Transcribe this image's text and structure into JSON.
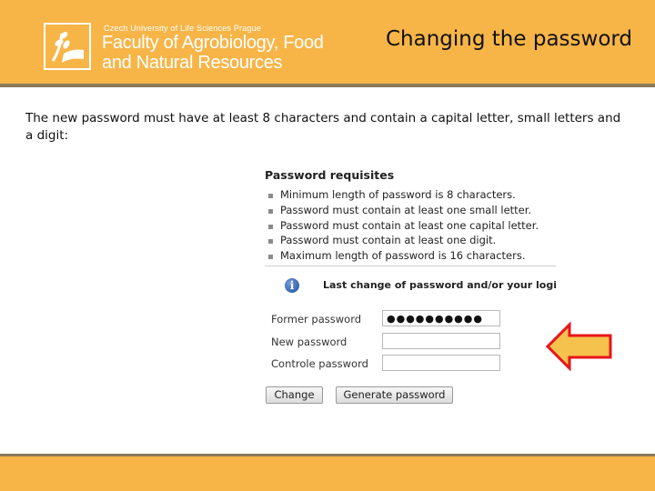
{
  "header": {
    "university": "Czech University of Life Sciences Prague",
    "faculty_line1": "Faculty of Agrobiology, Food",
    "faculty_line2": "and Natural Resources",
    "slide_title": "Changing the password"
  },
  "intro": {
    "text": "The new password must have at least 8 characters and contain a capital letter, small letters and a digit:"
  },
  "requisites": {
    "title": "Password requisites",
    "items": [
      "Minimum length of password is 8 characters.",
      "Password must contain at least one small letter.",
      "Password must contain at least one capital letter.",
      "Password must contain at least one digit.",
      "Maximum length of password is 16 characters."
    ]
  },
  "info": {
    "icon": "info-icon",
    "text": "Last change of password and/or your logi"
  },
  "form": {
    "former_label": "Former password",
    "former_value": "●●●●●●●●●●",
    "new_label": "New password",
    "new_value": "",
    "confirm_label": "Controle password",
    "confirm_value": ""
  },
  "buttons": {
    "change": "Change",
    "generate": "Generate password"
  },
  "colors": {
    "brand": "#F7B548",
    "arrow_fill": "#F5C24E",
    "arrow_stroke": "#E8141B"
  }
}
